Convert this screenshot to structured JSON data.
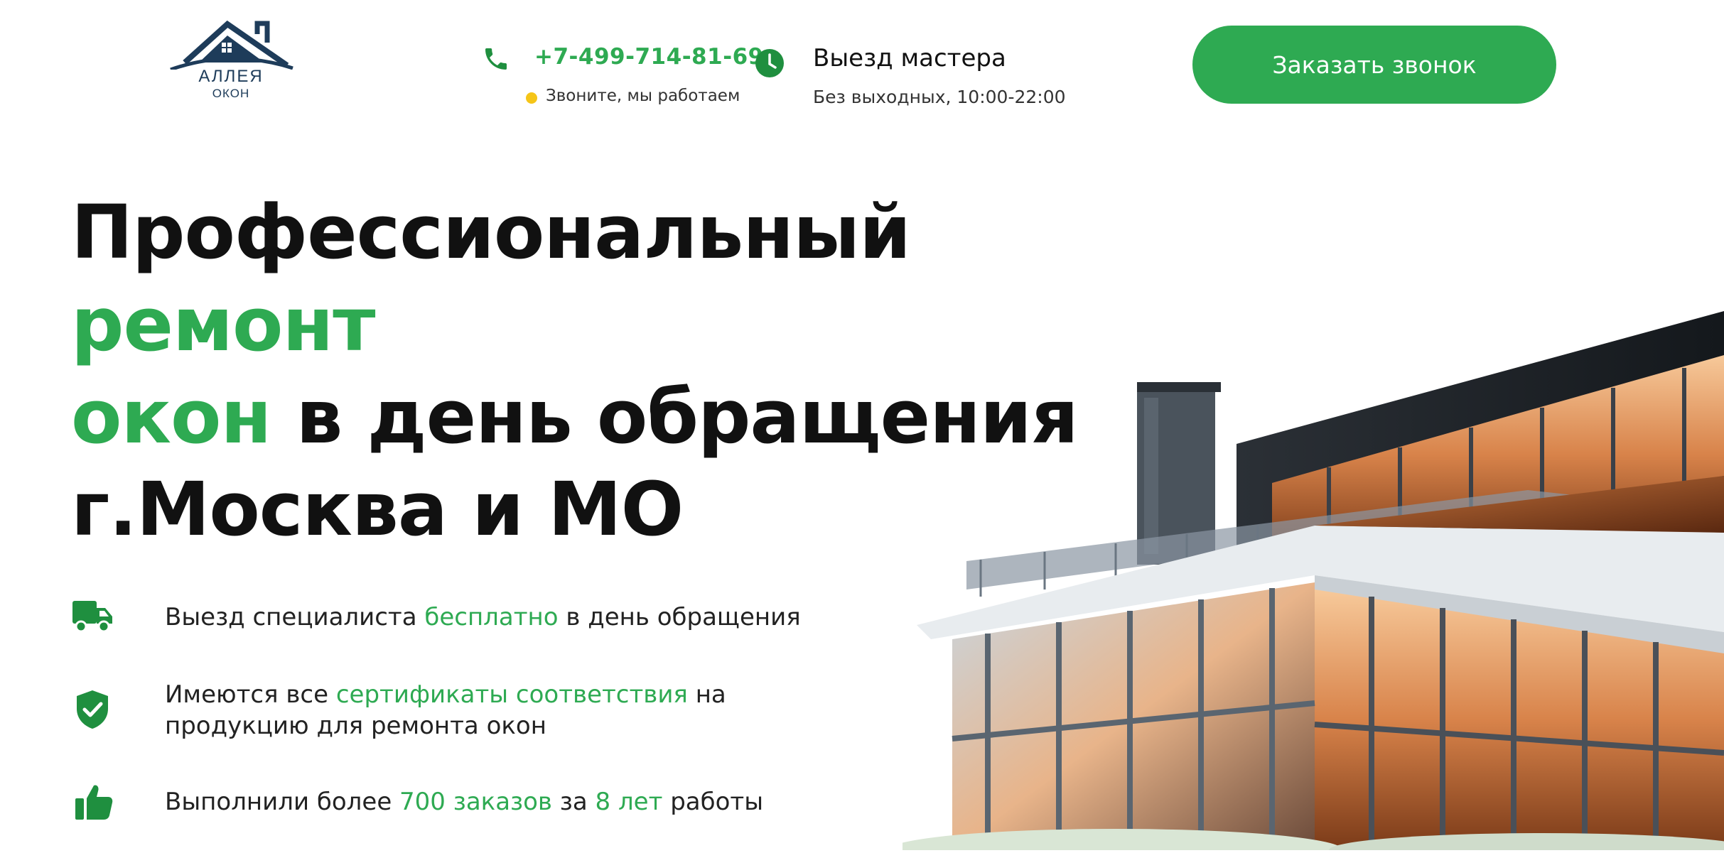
{
  "header": {
    "logo": {
      "title": "АЛЛЕЯ",
      "subtitle": "ОКОН"
    },
    "phone": {
      "number": "+7-499-714-81-69",
      "status": "Звоните, мы работаем"
    },
    "visit": {
      "title": "Выезд мастера",
      "hours": "Без выходных, 10:00-22:00"
    },
    "callback_button": "Заказать звонок"
  },
  "hero": {
    "title_part1": "Профессиональный ",
    "title_green1": "ремонт",
    "title_green2": "окон",
    "title_part2": " в день обращения",
    "title_line3": "г.Москва и МО"
  },
  "features": [
    {
      "icon": "truck-icon",
      "text_before": "Выезд специалиста ",
      "highlight": "бесплатно",
      "text_after": " в день обращения"
    },
    {
      "icon": "shield-check-icon",
      "text_before": "Имеются все ",
      "highlight": "сертификаты соответствия",
      "text_after": " на",
      "line2": "продукцию для ремонта окон"
    },
    {
      "icon": "thumbs-up-icon",
      "text_before": "Выполнили более ",
      "highlight": "700 заказов",
      "text_middle": " за ",
      "highlight2": "8 лет",
      "text_after": " работы"
    }
  ],
  "colors": {
    "accent": "#2eaa52",
    "status_dot": "#f5c518",
    "logo": "#1e3c5a"
  }
}
